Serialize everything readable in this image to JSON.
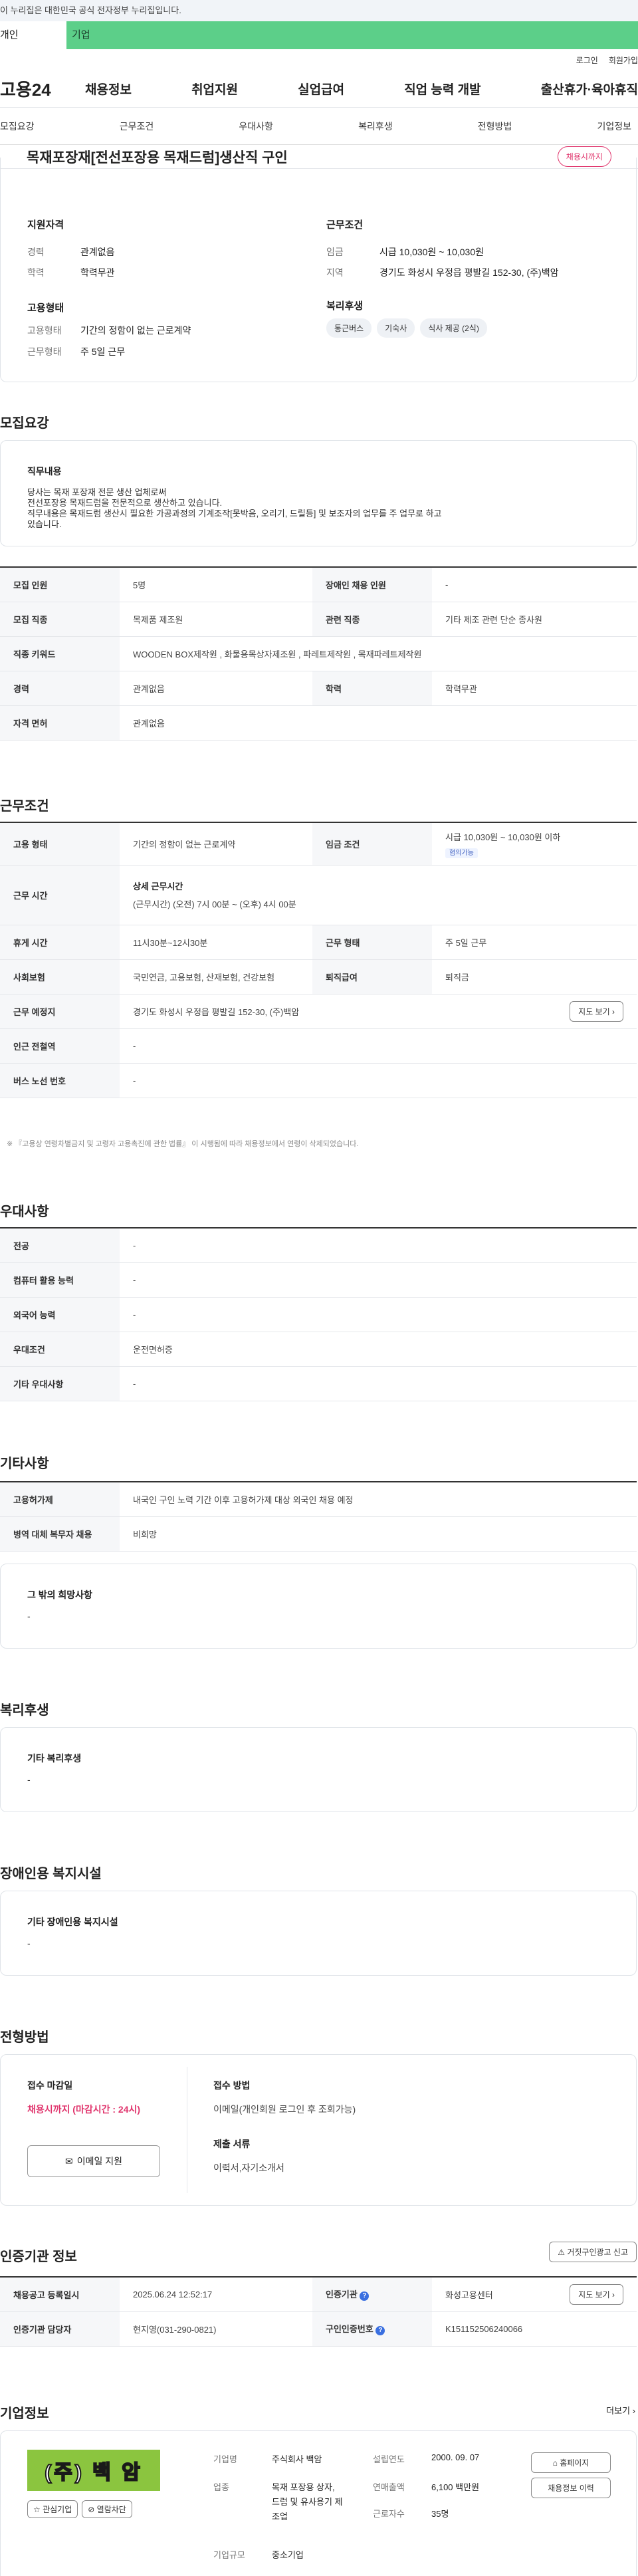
{
  "notice": "이 누리집은 대한민국 공식 전자정부 누리집입니다.",
  "usertabs": {
    "personal": "개인",
    "company": "기업"
  },
  "toplinks": {
    "login": "로그인",
    "join": "회원가입"
  },
  "logo": "고용24",
  "gnb": [
    "채용정보",
    "취업지원",
    "실업급여",
    "직업 능력 개발",
    "출산휴가·육아휴직"
  ],
  "snb": [
    "모집요강",
    "근무조건",
    "우대사항",
    "복리후생",
    "전형방법",
    "기업정보"
  ],
  "title": "목재포장재[전선포장용 목재드럼]생산직 구인",
  "status_badge": "채용시까지",
  "summary": {
    "qual_title": "지원자격",
    "career_label": "경력",
    "career": "관계없음",
    "edu_label": "학력",
    "edu": "학력무관",
    "emp_title": "고용형태",
    "emptype_label": "고용형태",
    "emptype": "기간의 정함이 없는 근로계약",
    "worktype_label": "근무형태",
    "worktype": "주 5일 근무",
    "cond_title": "근무조건",
    "wage_label": "임금",
    "wage": "시급 10,030원 ~ 10,030원",
    "region_label": "지역",
    "region": "경기도 화성시 우정읍 평발길 152-30, (주)백암",
    "welfare_title": "복리후생",
    "welfare_chips": [
      "통근버스",
      "기숙사",
      "식사 제공 (2식)"
    ]
  },
  "recruit": {
    "section": "모집요강",
    "duty_title": "직무내용",
    "duty_lines": [
      "당사는 목재 포장재 전문 생산 업체로써",
      "전선포장용 목재드럼을 전문적으로 생산하고 있습니다.",
      "직무내용은 목재드럼 생산시 필요한 가공과정의 기계조작[못박음, 오리기, 드릴등] 및 보조자의 업무를 주 업무로 하고",
      "있습니다."
    ],
    "rows": [
      {
        "k1": "모집 인원",
        "v1": "5명",
        "k2": "장애인 채용 인원",
        "v2": "-"
      },
      {
        "k1": "모집 직종",
        "v1": "목제품 제조원",
        "k2": "관련 직종",
        "v2": "기타 제조 관련 단순 종사원"
      },
      {
        "k1": "직종 키워드",
        "v1": "WOODEN BOX제작원 , 화물용목상자제조원 , 파레트제작원 , 목재파레트제작원",
        "k2": "",
        "v2": ""
      },
      {
        "k1": "경력",
        "v1": "관계없음",
        "k2": "학력",
        "v2": "학력무관"
      },
      {
        "k1": "자격 면허",
        "v1": "관계없음",
        "k2": "",
        "v2": ""
      }
    ]
  },
  "workcond": {
    "section": "근무조건",
    "emp_k": "고용 형태",
    "emp_v": "기간의 정함이 없는 근로계약",
    "wage_k": "임금 조건",
    "wage_v": "시급 10,030원 ~ 10,030원 이하",
    "wage_tag": "협의가능",
    "hours_k": "근무 시간",
    "hours_title": "상세 근무시간",
    "hours_v": "(근무시간) (오전) 7시 00분 ~ (오후) 4시 00분",
    "break_k": "휴게 시간",
    "break_v": "11시30분~12시30분",
    "wtype_k": "근무 형태",
    "wtype_v": "주 5일 근무",
    "ins_k": "사회보험",
    "ins_v": "국민연금, 고용보험, 산재보험, 건강보험",
    "ret_k": "퇴직급여",
    "ret_v": "퇴직금",
    "place_k": "근무 예정지",
    "place_v": "경기도 화성시 우정읍 평발길 152-30, (주)백암",
    "map_btn": "지도 보기",
    "subway_k": "인근 전철역",
    "subway_v": "-",
    "bus_k": "버스 노선 번호",
    "bus_v": "-",
    "footnote": "※ 『고용상 연령차별금지 및 고령자 고용촉진에 관한 법률』 이 시행됨에 따라 채용정보에서 연령이 삭제되었습니다."
  },
  "pref": {
    "section": "우대사항",
    "rows": [
      {
        "k": "전공",
        "v": "-"
      },
      {
        "k": "컴퓨터 활용 능력",
        "v": "-"
      },
      {
        "k": "외국어 능력",
        "v": "-"
      },
      {
        "k": "우대조건",
        "v": "운전면허증"
      },
      {
        "k": "기타 우대사항",
        "v": "-"
      }
    ]
  },
  "etc": {
    "section": "기타사항",
    "rows": [
      {
        "k": "고용허가제",
        "v": "내국인 구인 노력 기간 이후 고용허가제 대상 외국인 채용 예정"
      },
      {
        "k": "병역 대체 복무자 채용",
        "v": "비희망"
      }
    ],
    "other_title": "그 밖의 희망사항",
    "other_v": "-"
  },
  "welfare": {
    "section": "복리후생",
    "title": "기타 복리후생",
    "v": "-"
  },
  "disabled": {
    "section": "장애인용 복지시설",
    "title": "기타 장애인용 복지시설",
    "v": "-"
  },
  "screening": {
    "section": "전형방법",
    "deadline_title": "접수 마감일",
    "deadline_v": "채용시까지 (마감시간 : 24시)",
    "email_btn": "이메일 지원",
    "method_title": "접수 방법",
    "method_v": "이메일(개인회원 로그인 후 조회가능)",
    "docs_title": "제출 서류",
    "docs_v": "이력서,자기소개서"
  },
  "cert": {
    "section": "인증기관 정보",
    "report_btn": "거짓구인광고 신고",
    "date_k": "채용공고 등록일시",
    "date_v": "2025.06.24 12:52:17",
    "org_k": "인증기관",
    "org_v": "화성고용센터",
    "map_btn": "지도 보기",
    "staff_k": "인증기관 담당자",
    "staff_v": "현지영(031-290-0821)",
    "no_k": "구인인증번호",
    "no_v": "K151152506240066"
  },
  "company": {
    "section": "기업정보",
    "more": "더보기",
    "logo_text": "(주) 백 암",
    "fav_btn": "관심기업",
    "block_btn": "열람차단",
    "name_k": "기업명",
    "name_v": "주식회사 백암",
    "est_k": "설립연도",
    "est_v": "2000. 09. 07",
    "biz_k": "업종",
    "biz_v": "목재 포장용 상자, 드럼 및 유사용기 제조업",
    "sales_k": "연매출액",
    "sales_v": "6,100 백만원",
    "emp_k": "근로자수",
    "emp_v": "35명",
    "scale_k": "기업규모",
    "scale_v": "중소기업",
    "home_btn": "홈페이지",
    "history_btn": "채용정보 이력"
  }
}
